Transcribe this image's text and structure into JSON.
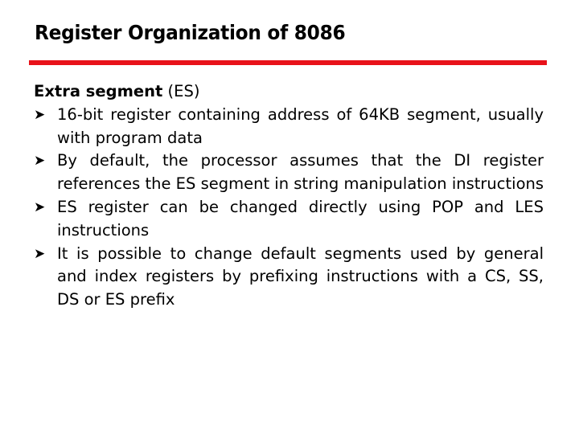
{
  "slide": {
    "title": "Register Organization of 8086",
    "accent_color": "#e8121a",
    "heading": {
      "bold": "Extra segment",
      "rest": " (ES)"
    },
    "bullet_icon": "arrow-bullet-icon",
    "bullets": [
      {
        "text": "16-bit register containing address of 64KB segment, usually with program data"
      },
      {
        "text": "By default, the processor assumes that the DI register references the ES segment in string manipulation instructions"
      },
      {
        "text": "ES register can be changed directly using POP and LES instructions"
      },
      {
        "text": "It is possible to change default segments used by general and index registers by prefixing instructions with a CS, SS, DS or ES prefix"
      }
    ]
  }
}
